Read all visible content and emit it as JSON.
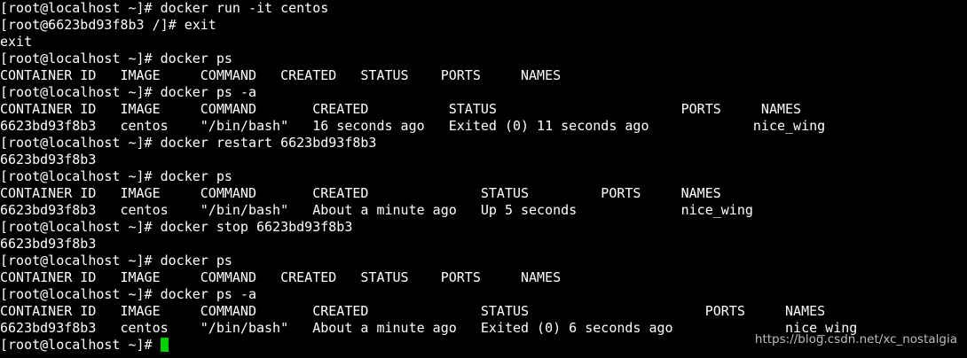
{
  "terminal": {
    "colors": {
      "background": "#000000",
      "text": "#ffffff",
      "cursor": "#00d000",
      "watermark": "#bdbdbd"
    },
    "lines": [
      "[root@localhost ~]# docker run -it centos",
      "[root@6623bd93f8b3 /]# exit",
      "exit",
      "[root@localhost ~]# docker ps",
      "CONTAINER ID   IMAGE     COMMAND   CREATED   STATUS    PORTS     NAMES",
      "[root@localhost ~]# docker ps -a",
      "CONTAINER ID   IMAGE     COMMAND       CREATED          STATUS                       PORTS     NAMES",
      "6623bd93f8b3   centos    \"/bin/bash\"   16 seconds ago   Exited (0) 11 seconds ago             nice_wing",
      "[root@localhost ~]# docker restart 6623bd93f8b3",
      "6623bd93f8b3",
      "[root@localhost ~]# docker ps",
      "CONTAINER ID   IMAGE     COMMAND       CREATED              STATUS         PORTS     NAMES",
      "6623bd93f8b3   centos    \"/bin/bash\"   About a minute ago   Up 5 seconds             nice_wing",
      "[root@localhost ~]# docker stop 6623bd93f8b3",
      "6623bd93f8b3",
      "[root@localhost ~]# docker ps",
      "CONTAINER ID   IMAGE     COMMAND   CREATED   STATUS    PORTS     NAMES",
      "[root@localhost ~]# docker ps -a",
      "CONTAINER ID   IMAGE     COMMAND       CREATED              STATUS                      PORTS     NAMES",
      "6623bd93f8b3   centos    \"/bin/bash\"   About a minute ago   Exited (0) 6 seconds ago              nice_wing"
    ],
    "prompt": "[root@localhost ~]# ",
    "watermark": "https://blog.csdn.net/xc_nostalgia"
  }
}
